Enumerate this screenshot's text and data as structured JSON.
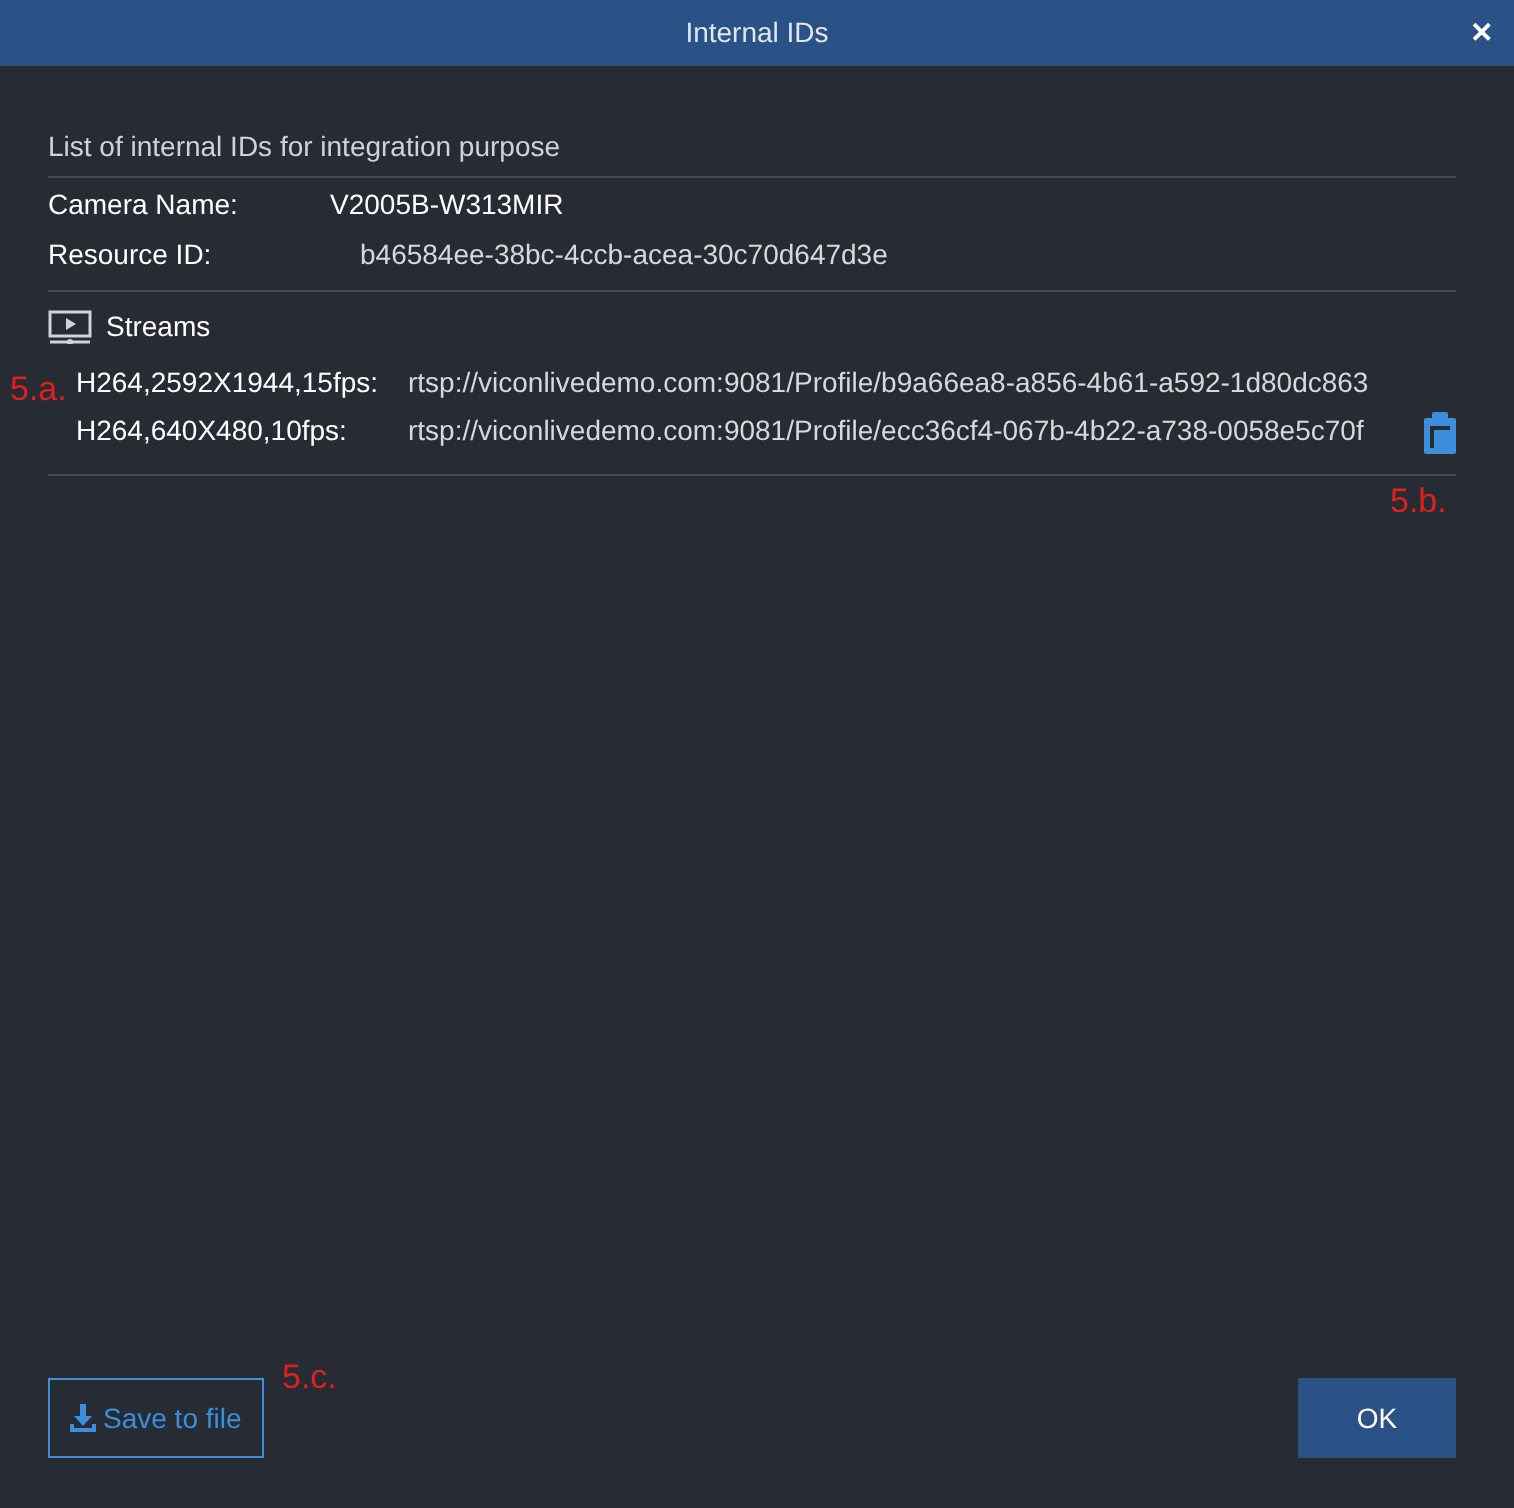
{
  "window": {
    "title": "Internal IDs",
    "close": "✕"
  },
  "description": "List of internal IDs for integration purpose",
  "fields": [
    {
      "label": "Camera Name:",
      "value": "V2005B-W313MIR"
    },
    {
      "label": "Resource ID:",
      "value": "b46584ee-38bc-4ccb-acea-30c70d647d3e"
    }
  ],
  "streams": {
    "title": "Streams",
    "items": [
      {
        "label": "H264,2592X1944,15fps:",
        "url": "rtsp://viconlivedemo.com:9081/Profile/b9a66ea8-a856-4b61-a592-1d80dc863"
      },
      {
        "label": "H264,640X480,10fps:",
        "url": "rtsp://viconlivedemo.com:9081/Profile/ecc36cf4-067b-4b22-a738-0058e5c70f"
      }
    ]
  },
  "buttons": [
    {
      "label": "Save to file",
      "kind": "outline"
    },
    {
      "label": "OK",
      "kind": "primary"
    }
  ],
  "annotations": [
    "5.a.",
    "5.b.",
    "5.c."
  ]
}
